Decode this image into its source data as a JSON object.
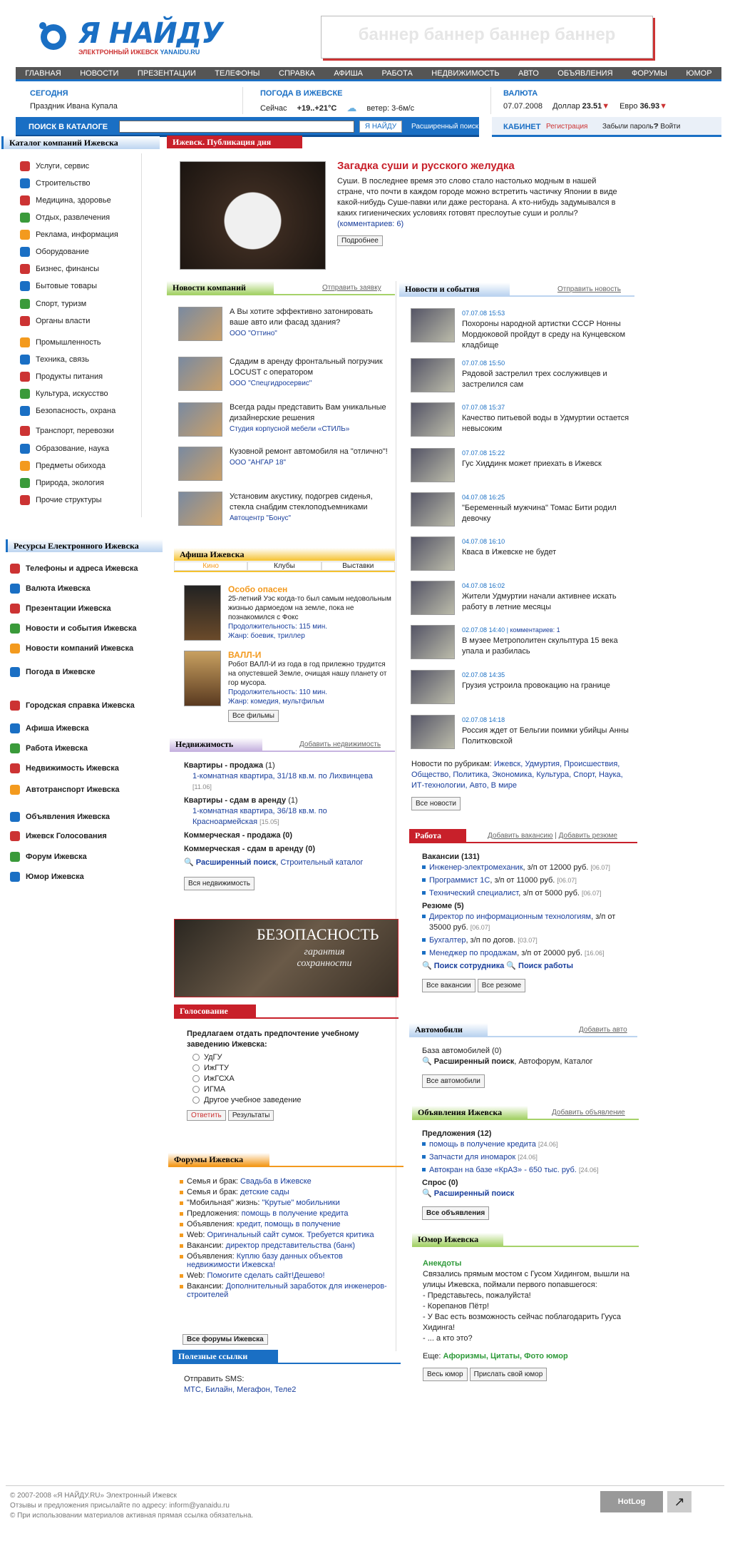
{
  "logo": {
    "title": "Я НАЙДУ",
    "subtitle": "ЭЛЕКТРОННЫЙ ИЖЕВСК",
    "domain": "YANAIDU.RU"
  },
  "banner": "баннер баннер баннер баннер",
  "menu": [
    "ГЛАВНАЯ",
    "НОВОСТИ",
    "ПРЕЗЕНТАЦИИ",
    "ТЕЛЕФОНЫ",
    "СПРАВКА",
    "АФИША",
    "РАБОТА",
    "НЕДВИЖИМОСТЬ",
    "АВТО",
    "ОБЪЯВЛЕНИЯ",
    "ФОРУМЫ",
    "ЮМОР"
  ],
  "today": {
    "head": "СЕГОДНЯ",
    "text": "Праздник Ивана Купала"
  },
  "weather": {
    "head": "ПОГОДА В ИЖЕВСКЕ",
    "now_label": "Сейчас",
    "temp": "+19..+21°C",
    "wind": "ветер: 3-6м/с"
  },
  "currency": {
    "head": "ВАЛЮТА",
    "date": "07.07.2008",
    "usd_label": "Доллар",
    "usd": "23.51",
    "eur_label": "Евро",
    "eur": "36.93"
  },
  "search": {
    "label": "ПОИСК В КАТАЛОГЕ",
    "button": "Я НАЙДУ",
    "advanced": "Расширенный поиск"
  },
  "cabinet": {
    "head": "КАБИНЕТ",
    "register": "Регистрация",
    "forgot": "Забыли пароль?",
    "login": "Войти"
  },
  "catalog": {
    "title": "Каталог компаний Ижевска",
    "items": [
      "Услуги, сервис",
      "Строительство",
      "Медицина, здоровье",
      "Отдых, развлечения",
      "Реклама, информация",
      "Оборудование",
      "Бизнес, финансы",
      "Бытовые товары",
      "Спорт, туризм",
      "Органы власти",
      "Промышленность",
      "Техника, связь",
      "Продукты питания",
      "Культура, искусство",
      "Безопасность, охрана",
      "Транспорт, перевозки",
      "Образование, наука",
      "Предметы обихода",
      "Природа, экология",
      "Прочие структуры"
    ]
  },
  "resources": {
    "title": "Ресурсы Електронного Ижевска",
    "items": [
      "Телефоны и адреса Ижевска",
      "Валюта Ижевска",
      "Презентации Ижевска",
      "Новости и события Ижевска",
      "Новости компаний Ижевска",
      "Погода в Ижевске",
      "Городская справка Ижевска",
      "Афиша Ижевска",
      "Работа Ижевска",
      "Недвижимость Ижевска",
      "Автотранспорт Ижевска",
      "Объявления Ижевска",
      "Ижевск Голосования",
      "Форум Ижевска",
      "Юмор Ижевска"
    ]
  },
  "publication": {
    "tab": "Ижевск. Публикация дня",
    "title": "Загадка суши и русского желудка",
    "text": "Суши. В последнее время это слово стало настолько модным в нашей стране, что почти в каждом городе можно встретить частичку Японии в виде какой-нибудь Суше-павки или даже ресторана. А кто-нибудь задумывался в каких гигиенических условиях готовят преслоутые суши и роллы?",
    "comments": "(комментариев: 6)",
    "more": "Подробнее"
  },
  "company_news": {
    "title": "Новости компаний",
    "link": "Отправить заявку",
    "items": [
      {
        "text": "А Вы хотите эффективно затонировать ваше авто или фасад здания?",
        "org": "ООО \"Оттино\""
      },
      {
        "text": "Сдадим в аренду фронтальный погрузчик LOCUST с оператором",
        "org": "ООО \"Спецгидросервис\""
      },
      {
        "text": "Всегда рады представить Вам уникальные дизайнерские решения",
        "org": "Студия корпусной мебели «СТИЛЬ»"
      },
      {
        "text": "Кузовной ремонт автомобиля на \"отлично\"!",
        "org": "ООО \"АНГАР 18\""
      },
      {
        "text": "Установим акустику, подогрев сиденья, стекла снабдим стеклоподъемниками",
        "org": "Автоцентр \"Бонус\""
      }
    ]
  },
  "afisha": {
    "title": "Афиша Ижевска",
    "tabs": [
      "Кино",
      "Клубы",
      "Выставки"
    ],
    "films": [
      {
        "title": "Особо опасен",
        "text": "25-летний Уэс когда-то был самым недовольным жизнью дармоедом на земле, пока не познакомился с Фокс",
        "dur": "Продолжительность: 115 мин.",
        "genre": "Жанр: боевик, триллер"
      },
      {
        "title": "ВАЛЛ-И",
        "text": "Робот ВАЛЛ-И из года в год прилежно трудится на опустевшей Земле, очищая нашу планету от гор мусора.",
        "dur": "Продолжительность: 110 мин.",
        "genre": "Жанр: комедия, мультфильм"
      }
    ],
    "all": "Все фильмы"
  },
  "realty": {
    "title": "Недвижимость",
    "link": "Добавить недвижимость",
    "sale_head": "Квартиры - продажа",
    "sale_count": "(1)",
    "sale_item": "1-комнатная квартира, 31/18 кв.м. по Лихвинцева",
    "sale_date": "[11.06]",
    "rent_head": "Квартиры - сдам в аренду",
    "rent_count": "(1)",
    "rent_item": "1-комнатная квартира, 36/18 кв.м. по Красноармейская",
    "rent_date": "[15.05]",
    "comm_sale": "Коммерческая - продажа (0)",
    "comm_rent": "Коммерческая - сдам в аренду (0)",
    "adv": "Расширенный поиск",
    "cat": "Строительный каталог",
    "all": "Вся недвижимость"
  },
  "security_banner": {
    "title": "БЕЗОПАСНОСТЬ",
    "sub": "гарантия сохранности"
  },
  "poll": {
    "title": "Голосование",
    "question": "Предлагаем отдать предпочтение учебному заведению Ижевска:",
    "options": [
      "УдГУ",
      "ИжГТУ",
      "ИжГСХА",
      "ИГМА",
      "Другое учебное заведение"
    ],
    "vote": "Ответить",
    "results": "Результаты"
  },
  "forums": {
    "title": "Форумы Ижевска",
    "items": [
      {
        "cat": "Семья и брак:",
        "link": "Свадьба в Ижевске"
      },
      {
        "cat": "Семья и брак:",
        "link": "детские сады"
      },
      {
        "cat": "\"Мобильная\" жизнь:",
        "link": "\"Крутые\" мобильники"
      },
      {
        "cat": "Предложения:",
        "link": "помощь в получение кредита"
      },
      {
        "cat": "Объявления:",
        "link": "кредит, помощь в получение"
      },
      {
        "cat": "Web:",
        "link": "Оригинальный сайт сумок. Требуется критика"
      },
      {
        "cat": "Вакансии:",
        "link": "директор представительства (банк)"
      },
      {
        "cat": "Объявления:",
        "link": "Куплю базу данных объектов недвижимости Ижевска!"
      },
      {
        "cat": "Web:",
        "link": "Помогите сделать сайт!Дешево!"
      },
      {
        "cat": "Вакансии:",
        "link": "Дополнительный заработок для инженеров-строителей"
      }
    ],
    "all": "Все форумы Ижевска"
  },
  "useful": {
    "title": "Полезные ссылки",
    "head": "Отправить SMS:",
    "links": "МТС, Билайн, Мегафон, Теле2"
  },
  "news": {
    "title": "Новости и события",
    "link": "Отправить новость",
    "items": [
      {
        "date": "07.07.08",
        "time": "15:53",
        "text": "Похороны народной артистки СССР Нонны Мордюковой пройдут в среду на Кунцевском кладбище"
      },
      {
        "date": "07.07.08",
        "time": "15:50",
        "text": "Рядовой застрелил трех сослуживцев и застрелился сам"
      },
      {
        "date": "07.07.08",
        "time": "15:37",
        "text": "Качество питьевой воды в Удмуртии остается невысоким"
      },
      {
        "date": "07.07.08",
        "time": "15:22",
        "text": "Гус Хиддинк может приехать в Ижевск"
      },
      {
        "date": "04.07.08",
        "time": "16:25",
        "text": "\"Беременный мужчина\" Томас Бити родил девочку"
      },
      {
        "date": "04.07.08",
        "time": "16:10",
        "text": "Кваса в Ижевске не будет"
      },
      {
        "date": "04.07.08",
        "time": "16:02",
        "text": "Жители Удмуртии начали активнее искать работу в летние месяцы"
      },
      {
        "date": "02.07.08",
        "time": "14:40",
        "text": "В музее Метрополитен скульптура 15 века упала и разбилась",
        "comments": "комментариев: 1"
      },
      {
        "date": "02.07.08",
        "time": "14:35",
        "text": "Грузия устроила провокацию на границе"
      },
      {
        "date": "02.07.08",
        "time": "14:18",
        "text": "Россия ждет от Бельгии поимки убийцы Анны Политковской"
      }
    ],
    "rubrics_label": "Новости по рубрикам:",
    "rubrics": "Ижевск, Удмуртия, Происшествия, Общество, Политика, Экономика, Культура, Спорт, Наука, ИТ-технологии, Авто, В мире",
    "all": "Все новости"
  },
  "work": {
    "title": "Работа",
    "link1": "Добавить вакансию",
    "link2": "Добавить резюме",
    "vac_head": "Вакансии (131)",
    "vacancies": [
      {
        "t": "Инженер-электромеханик",
        "s": ", з/п от 12000 руб.",
        "d": "[06.07]"
      },
      {
        "t": "Программист 1С",
        "s": ", з/п от 11000 руб.",
        "d": "[06.07]"
      },
      {
        "t": "Технический специалист",
        "s": ", з/п от 5000 руб.",
        "d": "[06.07]"
      }
    ],
    "res_head": "Резюме (5)",
    "resumes": [
      {
        "t": "Директор по информационным технологиям",
        "s": ", з/п от 35000 руб.",
        "d": "[06.07]"
      },
      {
        "t": "Бухгалтер",
        "s": ", з/п по догов.",
        "d": "[03.07]"
      },
      {
        "t": "Менеджер по продажам",
        "s": ", з/п от 20000 руб.",
        "d": "[16.06]"
      }
    ],
    "find1": "Поиск сотрудника",
    "find2": "Поиск работы",
    "all1": "Все вакансии",
    "all2": "Все резюме"
  },
  "auto": {
    "title": "Автомобили",
    "link": "Добавить авто",
    "base": "База автомобилей (0)",
    "adv": "Расширенный поиск",
    "more": ", Автофорум, Каталог",
    "all": "Все автомобили"
  },
  "ads": {
    "title": "Объявления Ижевска",
    "link": "Добавить объявление",
    "offers": "Предложения (12)",
    "items": [
      {
        "t": "помощь в получение кредита",
        "d": "[24.06]"
      },
      {
        "t": "Запчасти для иномарок",
        "d": "[24.06]"
      },
      {
        "t": "Автокран на базе «КрАЗ» - 650 тыс. руб.",
        "d": "[24.06]"
      }
    ],
    "demand": "Спрос (0)",
    "adv": "Расширенный поиск",
    "all": "Все объявления"
  },
  "humor": {
    "title": "Юмор Ижевска",
    "head": "Анекдоты",
    "text": [
      "Связались прямым мостом с Гусом Хидингом, вышли на улицы Ижевска, поймали первого попавшегося:",
      "- Представьтесь, пожалуйста!",
      "- Корепанов Пётр!",
      "- У Вас есть возможность сейчас поблагодарить Гууса Хидинга!",
      "- ... а кто это?"
    ],
    "more_label": "Еще:",
    "more": "Афоризмы, Цитаты, Фото юмор",
    "all": "Весь юмор",
    "send": "Прислать свой юмор"
  },
  "footer": {
    "line1": "© 2007-2008 «Я НАЙДУ.RU» Электронный Ижевск",
    "line2": "Отзывы и предложения присылайте по адресу: inform@yanaidu.ru",
    "line3": "При использовании материалов активная прямая ссылка обязательна.",
    "counter": "HotLog"
  }
}
